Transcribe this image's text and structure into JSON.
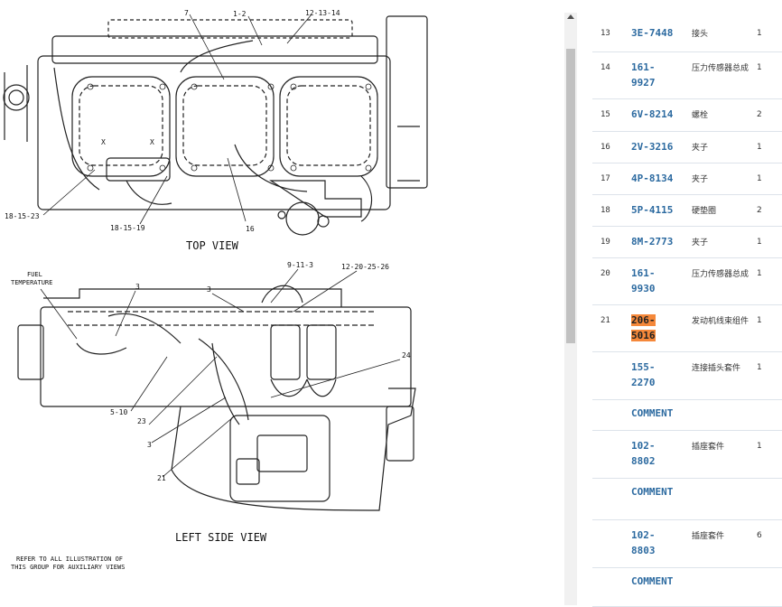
{
  "diagram": {
    "view_top": "TOP VIEW",
    "view_left": "LEFT SIDE VIEW",
    "note_line1": "REFER TO ALL ILLUSTRATION OF",
    "note_line2": "THIS GROUP FOR AUXILIARY VIEWS",
    "fuel_temp_1": "FUEL",
    "fuel_temp_2": "TEMPERATURE",
    "callouts_top": [
      "7",
      "1-2",
      "12-13-14",
      "18-15-23",
      "18-15-19",
      "16",
      "X",
      "X"
    ],
    "callouts_side": [
      "9-11-3",
      "12-20-25-26",
      "3",
      "3",
      "5-10",
      "23",
      "3",
      "21",
      "24"
    ]
  },
  "parts": [
    {
      "idx": "13",
      "pn": [
        "3E-7448"
      ],
      "name": "接头",
      "qty": "1"
    },
    {
      "idx": "14",
      "pn": [
        "161-",
        "9927"
      ],
      "name": "压力传感器总成",
      "qty": "1"
    },
    {
      "idx": "15",
      "pn": [
        "6V-8214"
      ],
      "name": "螺栓",
      "qty": "2"
    },
    {
      "idx": "16",
      "pn": [
        "2V-3216"
      ],
      "name": "夹子",
      "qty": "1"
    },
    {
      "idx": "17",
      "pn": [
        "4P-8134"
      ],
      "name": "夹子",
      "qty": "1"
    },
    {
      "idx": "18",
      "pn": [
        "5P-4115"
      ],
      "name": "硬垫圈",
      "qty": "2"
    },
    {
      "idx": "19",
      "pn": [
        "8M-2773"
      ],
      "name": "夹子",
      "qty": "1"
    },
    {
      "idx": "20",
      "pn": [
        "161-",
        "9930"
      ],
      "name": "压力传感器总成",
      "qty": "1"
    },
    {
      "idx": "21",
      "pn": [
        "206-",
        "5016"
      ],
      "name": "发动机线束组件",
      "qty": "1",
      "highlight": true
    },
    {
      "idx": "",
      "pn": [
        "155-",
        "2270"
      ],
      "name": "连接插头套件",
      "qty": "1"
    },
    {
      "idx": "",
      "comment": "COMMENT"
    },
    {
      "idx": "",
      "pn": [
        "102-",
        "8802"
      ],
      "name": "插座套件",
      "qty": "1"
    },
    {
      "idx": "",
      "comment": "COMMENT"
    },
    {
      "idx": "",
      "pn": [
        "102-",
        "8803"
      ],
      "name": "插座套件",
      "qty": "6"
    },
    {
      "idx": "",
      "comment": "COMMENT"
    }
  ]
}
